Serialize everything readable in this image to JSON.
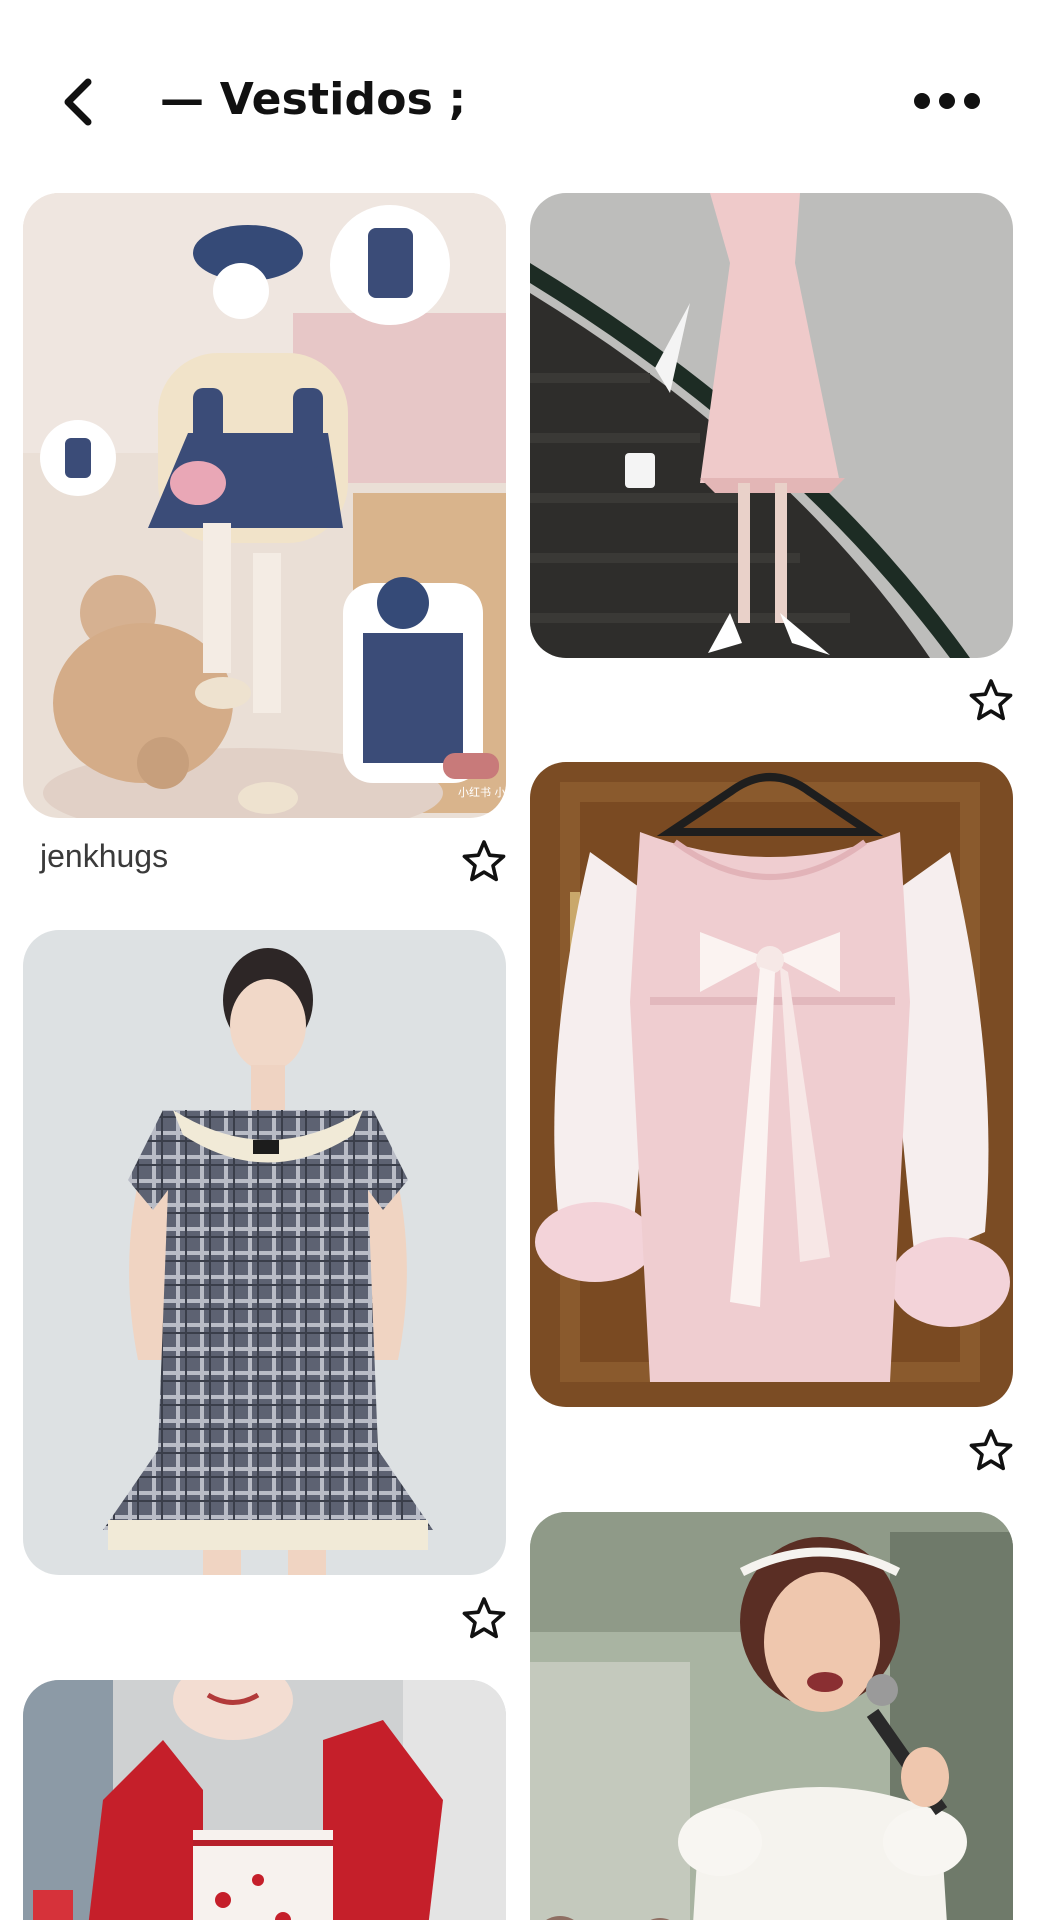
{
  "header": {
    "title": "— Vestidos ;",
    "back_icon": "chevron-left-icon",
    "more_icon": "more-horizontal-icon"
  },
  "pins": [
    {
      "id": "denim-pinafore",
      "caption": "",
      "watermark": "小红书 小红书号: 437793866",
      "colors": {
        "bg": "#e9ddd4",
        "dress": "#3a4a72",
        "accent": "#e8a6b5"
      }
    },
    {
      "id": "pink-satin-dress",
      "caption": "",
      "colors": {
        "bg": "#b9b9b9",
        "dress": "#efc9c9"
      }
    },
    {
      "id": "jenkhugs-caption",
      "caption": "jenkhugs"
    },
    {
      "id": "pink-bow-dress",
      "caption": "",
      "colors": {
        "bg": "#7a4a22",
        "dress": "#efcdd0"
      }
    },
    {
      "id": "plaid-dress",
      "caption": "",
      "colors": {
        "bg": "#dde0e2",
        "dress": "#5c6170"
      }
    },
    {
      "id": "red-cardigan",
      "caption": "",
      "colors": {
        "bg": "#c9c9c9",
        "dress": "#c0202a"
      }
    },
    {
      "id": "singer-white-dress",
      "caption": "",
      "colors": {
        "bg": "#a7b39f",
        "dress": "#f3f1ec"
      }
    }
  ],
  "save_icon": "star-outline-icon"
}
